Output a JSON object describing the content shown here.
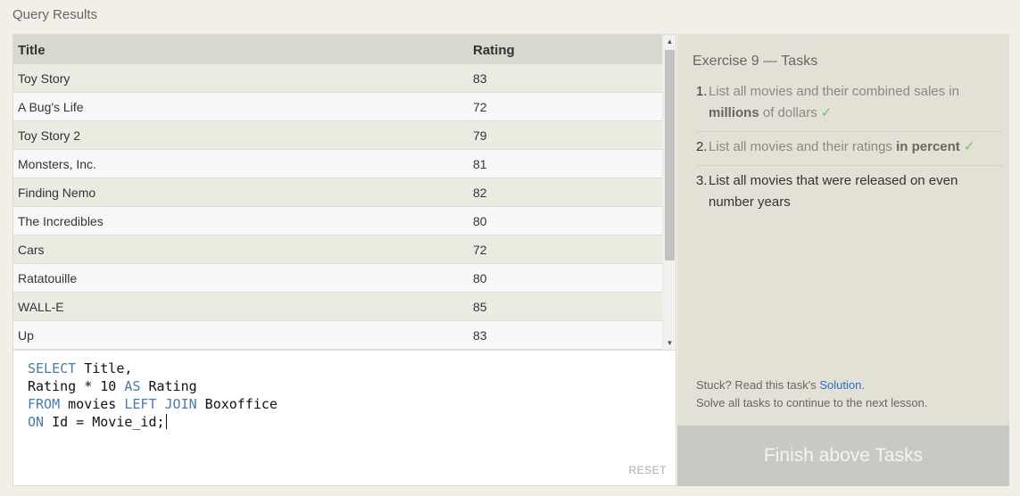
{
  "header": {
    "title": "Query Results"
  },
  "results": {
    "columns": [
      "Title",
      "Rating"
    ],
    "rows": [
      [
        "Toy Story",
        "83"
      ],
      [
        "A Bug's Life",
        "72"
      ],
      [
        "Toy Story 2",
        "79"
      ],
      [
        "Monsters, Inc.",
        "81"
      ],
      [
        "Finding Nemo",
        "82"
      ],
      [
        "The Incredibles",
        "80"
      ],
      [
        "Cars",
        "72"
      ],
      [
        "Ratatouille",
        "80"
      ],
      [
        "WALL-E",
        "85"
      ],
      [
        "Up",
        "83"
      ]
    ]
  },
  "editor": {
    "lines": [
      [
        {
          "kw": "SELECT"
        },
        {
          "t": " Title,"
        }
      ],
      [
        {
          "t": "Rating * 10 "
        },
        {
          "kw": "AS"
        },
        {
          "t": " Rating"
        }
      ],
      [
        {
          "kw": "FROM"
        },
        {
          "t": " movies "
        },
        {
          "kw": "LEFT JOIN"
        },
        {
          "t": " Boxoffice"
        }
      ],
      [
        {
          "kw": "ON"
        },
        {
          "t": " Id = Movie_id;"
        }
      ]
    ],
    "reset_label": "RESET"
  },
  "tasks": {
    "title": "Exercise 9 — Tasks",
    "items": [
      {
        "num": "1.",
        "pre": "List all movies and their combined sales in ",
        "bold": "millions",
        "post": " of dollars",
        "done": true
      },
      {
        "num": "2.",
        "pre": "List all movies and their ratings ",
        "bold": "in percent",
        "post": "",
        "done": true
      },
      {
        "num": "3.",
        "pre": "List all movies that were released on even number years",
        "bold": "",
        "post": "",
        "done": false
      }
    ],
    "check_glyph": "✓",
    "stuck_pre": "Stuck? Read this task's ",
    "solution_link": "Solution",
    "stuck_post": ".",
    "continue_text": "Solve all tasks to continue to the next lesson."
  },
  "finish_button": {
    "label": "Finish above Tasks"
  },
  "colors": {
    "keyword": "#4a7aa8",
    "link": "#2e6fbd",
    "check": "#7ab87a",
    "finish_bg": "#c8c8c5"
  }
}
